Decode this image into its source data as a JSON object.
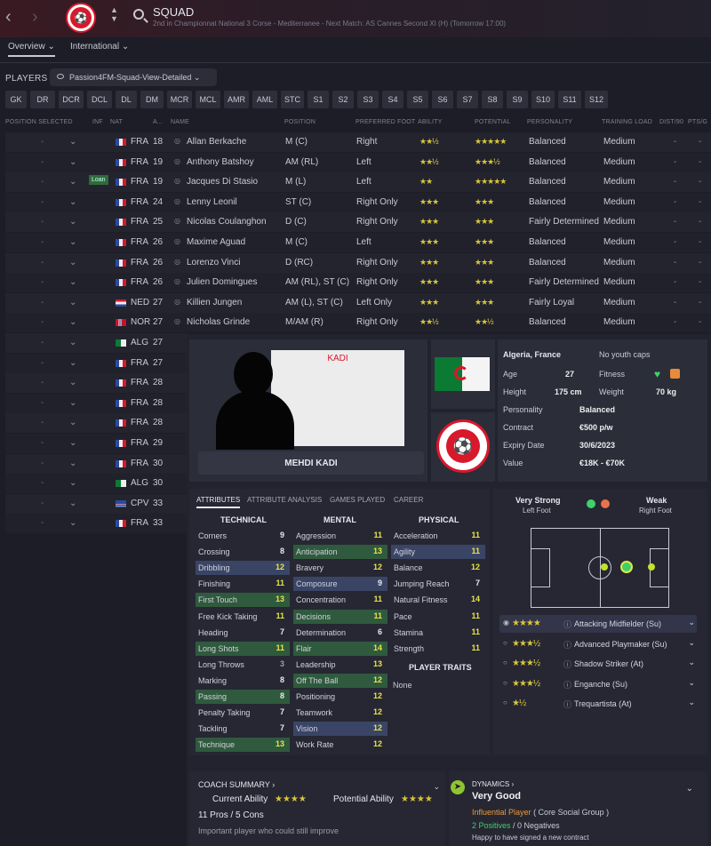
{
  "header": {
    "title": "SQUAD",
    "subtitle": "2nd in Championnat National 3 Corse - Mediterranee - Next Match: AS Cannes Second XI (H) (Tomorrow 17:00)"
  },
  "tabs": [
    {
      "label": "Overview"
    },
    {
      "label": "International"
    }
  ],
  "players_label": "PLAYERS",
  "view": "Passion4FM-Squad-View-Detailed",
  "positions": [
    "GK",
    "DR",
    "DCR",
    "DCL",
    "DL",
    "DM",
    "MCR",
    "MCL",
    "AMR",
    "AML",
    "STC",
    "S1",
    "S2",
    "S3",
    "S4",
    "S5",
    "S6",
    "S7",
    "S8",
    "S9",
    "S10",
    "S11",
    "S12"
  ],
  "columns": [
    "POSITION SELECTED",
    "INF",
    "NAT",
    "A...",
    "NAME",
    "POSITION",
    "PREFERRED FOOT",
    "ABILITY",
    "POTENTIAL",
    "PERSONALITY",
    "TRAINING LOAD",
    "DIST/90",
    "PTS/G"
  ],
  "rows": [
    {
      "nat": "FRA",
      "age": "18",
      "name": "Allan Berkache",
      "pos": "M (C)",
      "foot": "Right",
      "abil": "★★½",
      "pot": "★★★★★",
      "pers": "Balanced",
      "load": "Medium",
      "inf": ""
    },
    {
      "nat": "FRA",
      "age": "19",
      "name": "Anthony Batshoy",
      "pos": "AM (RL)",
      "foot": "Left",
      "abil": "★★½",
      "pot": "★★★½",
      "pers": "Balanced",
      "load": "Medium",
      "inf": ""
    },
    {
      "nat": "FRA",
      "age": "19",
      "name": "Jacques Di Stasio",
      "pos": "M (L)",
      "foot": "Left",
      "abil": "★★",
      "pot": "★★★★★",
      "pers": "Balanced",
      "load": "Medium",
      "inf": "Loan"
    },
    {
      "nat": "FRA",
      "age": "24",
      "name": "Lenny Leonil",
      "pos": "ST (C)",
      "foot": "Right Only",
      "abil": "★★★",
      "pot": "★★★",
      "pers": "Balanced",
      "load": "Medium",
      "inf": ""
    },
    {
      "nat": "FRA",
      "age": "25",
      "name": "Nicolas Coulanghon",
      "pos": "D (C)",
      "foot": "Right Only",
      "abil": "★★★",
      "pot": "★★★",
      "pers": "Fairly Determined",
      "load": "Medium",
      "inf": ""
    },
    {
      "nat": "FRA",
      "age": "26",
      "name": "Maxime Aguad",
      "pos": "M (C)",
      "foot": "Left",
      "abil": "★★★",
      "pot": "★★★",
      "pers": "Balanced",
      "load": "Medium",
      "inf": ""
    },
    {
      "nat": "FRA",
      "age": "26",
      "name": "Lorenzo Vinci",
      "pos": "D (RC)",
      "foot": "Right Only",
      "abil": "★★★",
      "pot": "★★★",
      "pers": "Balanced",
      "load": "Medium",
      "inf": ""
    },
    {
      "nat": "FRA",
      "age": "26",
      "name": "Julien Domingues",
      "pos": "AM (RL), ST (C)",
      "foot": "Right Only",
      "abil": "★★★",
      "pot": "★★★",
      "pers": "Fairly Determined",
      "load": "Medium",
      "inf": ""
    },
    {
      "nat": "NED",
      "age": "27",
      "name": "Killien Jungen",
      "pos": "AM (L), ST (C)",
      "foot": "Left Only",
      "abil": "★★★",
      "pot": "★★★",
      "pers": "Fairly Loyal",
      "load": "Medium",
      "inf": ""
    },
    {
      "nat": "NOR",
      "age": "27",
      "name": "Nicholas Grinde",
      "pos": "M/AM (R)",
      "foot": "Right Only",
      "abil": "★★½",
      "pot": "★★½",
      "pers": "Balanced",
      "load": "Medium",
      "inf": ""
    },
    {
      "nat": "ALG",
      "age": "27"
    },
    {
      "nat": "FRA",
      "age": "27"
    },
    {
      "nat": "FRA",
      "age": "28"
    },
    {
      "nat": "FRA",
      "age": "28"
    },
    {
      "nat": "FRA",
      "age": "28"
    },
    {
      "nat": "FRA",
      "age": "29"
    },
    {
      "nat": "FRA",
      "age": "30"
    },
    {
      "nat": "ALG",
      "age": "30"
    },
    {
      "nat": "CPV",
      "age": "33"
    },
    {
      "nat": "FRA",
      "age": "33"
    }
  ],
  "profile": {
    "name": "MEHDI KADI",
    "shirt": "KADI",
    "nations": "Algeria, France",
    "youth": "No youth caps",
    "age_l": "Age",
    "age": "27",
    "fitness_l": "Fitness",
    "height_l": "Height",
    "height": "175 cm",
    "weight_l": "Weight",
    "weight": "70 kg",
    "pers_l": "Personality",
    "pers": "Balanced",
    "contract_l": "Contract",
    "contract": "€500 p/w",
    "expiry_l": "Expiry Date",
    "expiry": "30/6/2023",
    "value_l": "Value",
    "value": "€18K - €70K"
  },
  "attr_tabs": [
    "ATTRIBUTES",
    "ATTRIBUTE ANALYSIS",
    "GAMES PLAYED",
    "CAREER"
  ],
  "technical_h": "TECHNICAL",
  "mental_h": "MENTAL",
  "physical_h": "PHYSICAL",
  "technical": [
    [
      "Corners",
      "9",
      "w",
      ""
    ],
    [
      "Crossing",
      "8",
      "w",
      ""
    ],
    [
      "Dribbling",
      "12",
      "y",
      "b"
    ],
    [
      "Finishing",
      "11",
      "y",
      ""
    ],
    [
      "First Touch",
      "13",
      "y",
      "g"
    ],
    [
      "Free Kick Taking",
      "11",
      "y",
      ""
    ],
    [
      "Heading",
      "7",
      "w",
      ""
    ],
    [
      "Long Shots",
      "11",
      "y",
      "g"
    ],
    [
      "Long Throws",
      "3",
      "g",
      ""
    ],
    [
      "Marking",
      "8",
      "w",
      ""
    ],
    [
      "Passing",
      "8",
      "w",
      "g"
    ],
    [
      "Penalty Taking",
      "7",
      "w",
      ""
    ],
    [
      "Tackling",
      "7",
      "w",
      ""
    ],
    [
      "Technique",
      "13",
      "y",
      "g"
    ]
  ],
  "mental": [
    [
      "Aggression",
      "11",
      "y",
      ""
    ],
    [
      "Anticipation",
      "13",
      "y",
      "g"
    ],
    [
      "Bravery",
      "12",
      "y",
      ""
    ],
    [
      "Composure",
      "9",
      "w",
      "b"
    ],
    [
      "Concentration",
      "11",
      "y",
      ""
    ],
    [
      "Decisions",
      "11",
      "y",
      "g"
    ],
    [
      "Determination",
      "6",
      "w",
      ""
    ],
    [
      "Flair",
      "14",
      "y",
      "g"
    ],
    [
      "Leadership",
      "13",
      "y",
      ""
    ],
    [
      "Off The Ball",
      "12",
      "y",
      "g"
    ],
    [
      "Positioning",
      "12",
      "y",
      ""
    ],
    [
      "Teamwork",
      "12",
      "y",
      ""
    ],
    [
      "Vision",
      "12",
      "y",
      "b"
    ],
    [
      "Work Rate",
      "12",
      "y",
      ""
    ]
  ],
  "physical": [
    [
      "Acceleration",
      "11",
      "y",
      ""
    ],
    [
      "Agility",
      "11",
      "y",
      "b"
    ],
    [
      "Balance",
      "12",
      "y",
      ""
    ],
    [
      "Jumping Reach",
      "7",
      "w",
      ""
    ],
    [
      "Natural Fitness",
      "14",
      "y",
      ""
    ],
    [
      "Pace",
      "11",
      "y",
      ""
    ],
    [
      "Stamina",
      "11",
      "y",
      ""
    ],
    [
      "Strength",
      "11",
      "y",
      ""
    ]
  ],
  "traits_h": "PLAYER TRAITS",
  "traits": "None",
  "foot": {
    "strong": "Very Strong",
    "strong_sub": "Left Foot",
    "weak": "Weak",
    "weak_sub": "Right Foot"
  },
  "roles": [
    {
      "stars": "★★★★",
      "name": "Attacking Midfielder (Su)"
    },
    {
      "stars": "★★★½",
      "name": "Advanced Playmaker (Su)"
    },
    {
      "stars": "★★★½",
      "name": "Shadow Striker (At)"
    },
    {
      "stars": "★★★½",
      "name": "Enganche (Su)"
    },
    {
      "stars": "★½",
      "name": "Trequartista (At)"
    }
  ],
  "coach": {
    "title": "COACH SUMMARY",
    "cur_l": "Current Ability",
    "cur": "★★★★",
    "pot_l": "Potential Ability",
    "pot": "★★★★",
    "pros": "11 Pros / 5 Cons",
    "note": "Important player who could still improve"
  },
  "dynamics": {
    "title": "DYNAMICS",
    "rating": "Very Good",
    "group": "Influential Player",
    "group_sub": "( Core Social Group )",
    "pos": "2 Positives",
    "neg": "0 Negatives",
    "note": "Happy to have signed a new contract"
  },
  "colors": {
    "accent": "#d8182b",
    "green": "#2f5a3d",
    "blue": "#3a4566",
    "star": "#d8c63b"
  }
}
